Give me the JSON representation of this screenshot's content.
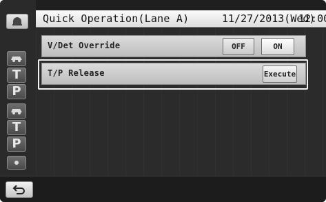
{
  "header": {
    "title": "Quick Operation(Lane A)",
    "date": "11/27/2013(Wed)",
    "time": "12:00"
  },
  "rail": {
    "items": [
      {
        "icon": "car-icon"
      },
      {
        "label": "T"
      },
      {
        "label": "P"
      },
      {
        "icon": "car-icon"
      },
      {
        "label": "T"
      },
      {
        "label": "P"
      },
      {
        "icon": "dot-icon"
      }
    ]
  },
  "rows": [
    {
      "label": "V/Det Override",
      "buttons": {
        "off": "OFF",
        "on": "ON"
      }
    },
    {
      "label": "T/P Release",
      "buttons": {
        "execute": "Execute"
      }
    }
  ],
  "icons": {
    "home": "home-icon",
    "back": "back-arrow-icon"
  }
}
